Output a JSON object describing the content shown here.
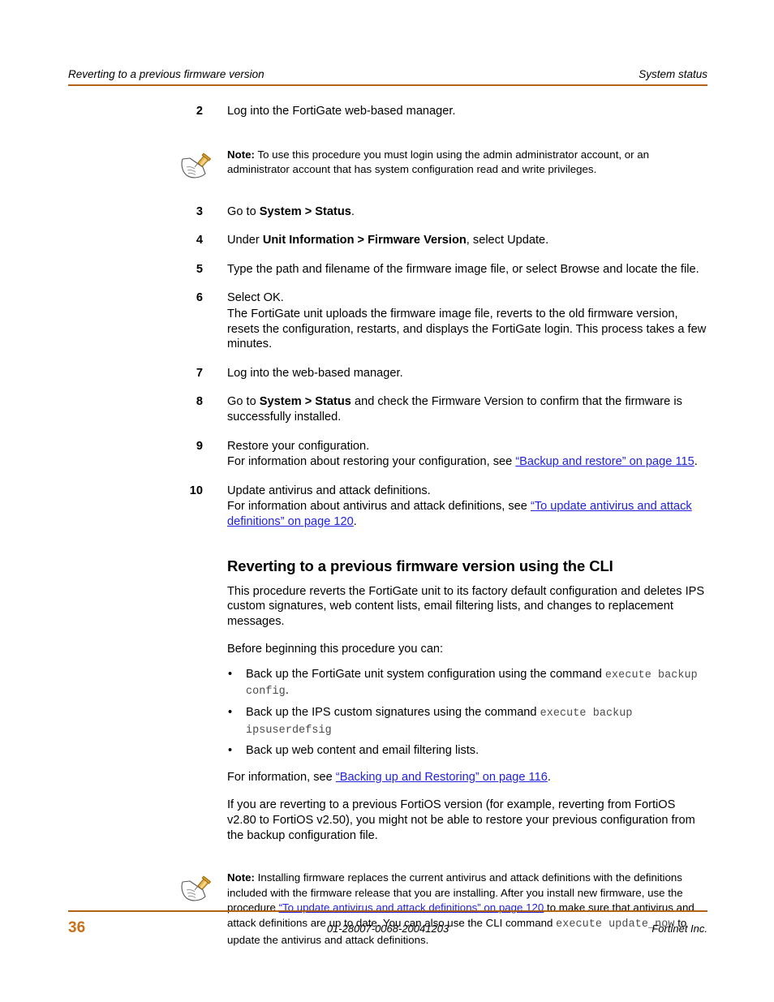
{
  "header": {
    "left": "Reverting to a previous firmware version",
    "right": "System status"
  },
  "footer": {
    "page_number": "36",
    "doc_id": "01-28007-0068-20041203",
    "company": "Fortinet Inc."
  },
  "colors": {
    "rule": "#b3621a",
    "page_number": "#c8711a",
    "link": "#2222dd",
    "mono": "#4a4a4a"
  },
  "steps": [
    {
      "num": "2",
      "lines": [
        "Log into the FortiGate web-based manager."
      ]
    },
    {
      "num": "3",
      "lead": "Go to ",
      "bold": "System > Status",
      "tail": "."
    },
    {
      "num": "4",
      "lead": "Under ",
      "bold": "Unit Information > Firmware Version",
      "tail": ", select Update."
    },
    {
      "num": "5",
      "lines": [
        "Type the path and filename of the firmware image file, or select Browse and locate the file."
      ]
    },
    {
      "num": "6",
      "lines": [
        "Select OK.",
        "The FortiGate unit uploads the firmware image file, reverts to the old firmware version, resets the configuration, restarts, and displays the FortiGate login. This process takes a few minutes."
      ]
    },
    {
      "num": "7",
      "lines": [
        "Log into the web-based manager."
      ]
    },
    {
      "num": "8",
      "lead": "Go to ",
      "bold": "System > Status",
      "tail": " and check the Firmware Version to confirm that the firmware is successfully installed."
    },
    {
      "num": "9",
      "lines": [
        "Restore your configuration."
      ],
      "ref_lead": "For information about restoring your configuration, see ",
      "ref_link": "“Backup and restore” on page 115",
      "ref_tail": "."
    },
    {
      "num": "10",
      "lines": [
        "Update antivirus and attack definitions."
      ],
      "ref_lead": "For information about antivirus and attack definitions, see ",
      "ref_link": "“To update antivirus and attack definitions” on page 120",
      "ref_tail": "."
    }
  ],
  "note_top": {
    "label": "Note:",
    "text": " To use this procedure you must login using the admin administrator account, or an administrator account that has system configuration read and write privileges."
  },
  "section": {
    "heading": "Reverting to a previous firmware version using the CLI",
    "intro": "This procedure reverts the FortiGate unit to its factory default configuration and deletes IPS custom signatures, web content lists, email filtering lists, and changes to replacement messages.",
    "before": "Before beginning this procedure you can:",
    "bullets": [
      {
        "marker": "•",
        "lead": "Back up the FortiGate unit system configuration using the command ",
        "code": "execute backup config",
        "tail": "."
      },
      {
        "marker": "•",
        "lead": "Back up the IPS custom signatures using the command ",
        "code": "execute backup ipsuserdefsig",
        "tail": ""
      },
      {
        "marker": "•",
        "lead": "Back up web content and email filtering lists.",
        "code": "",
        "tail": ""
      }
    ],
    "info_lead": "For information, see ",
    "info_link": "“Backing up and Restoring” on page 116",
    "info_tail": ".",
    "revert_para": "If you are reverting to a previous FortiOS version (for example, reverting from FortiOS v2.80 to FortiOS v2.50), you might not be able to restore your previous configuration from the backup configuration file."
  },
  "note_bottom": {
    "label": "Note:",
    "text1": " Installing firmware replaces the current antivirus and attack definitions with the definitions included with the firmware release that you are installing. After you install new firmware, use the procedure ",
    "link": "“To update antivirus and attack definitions” on page 120",
    "text2": " to make sure that antivirus and attack definitions are up to date. You can also use the CLI command ",
    "code": "execute update_now",
    "text3": " to update the antivirus and attack definitions."
  },
  "icons": {
    "note": "note-paper-pointer-icon"
  }
}
